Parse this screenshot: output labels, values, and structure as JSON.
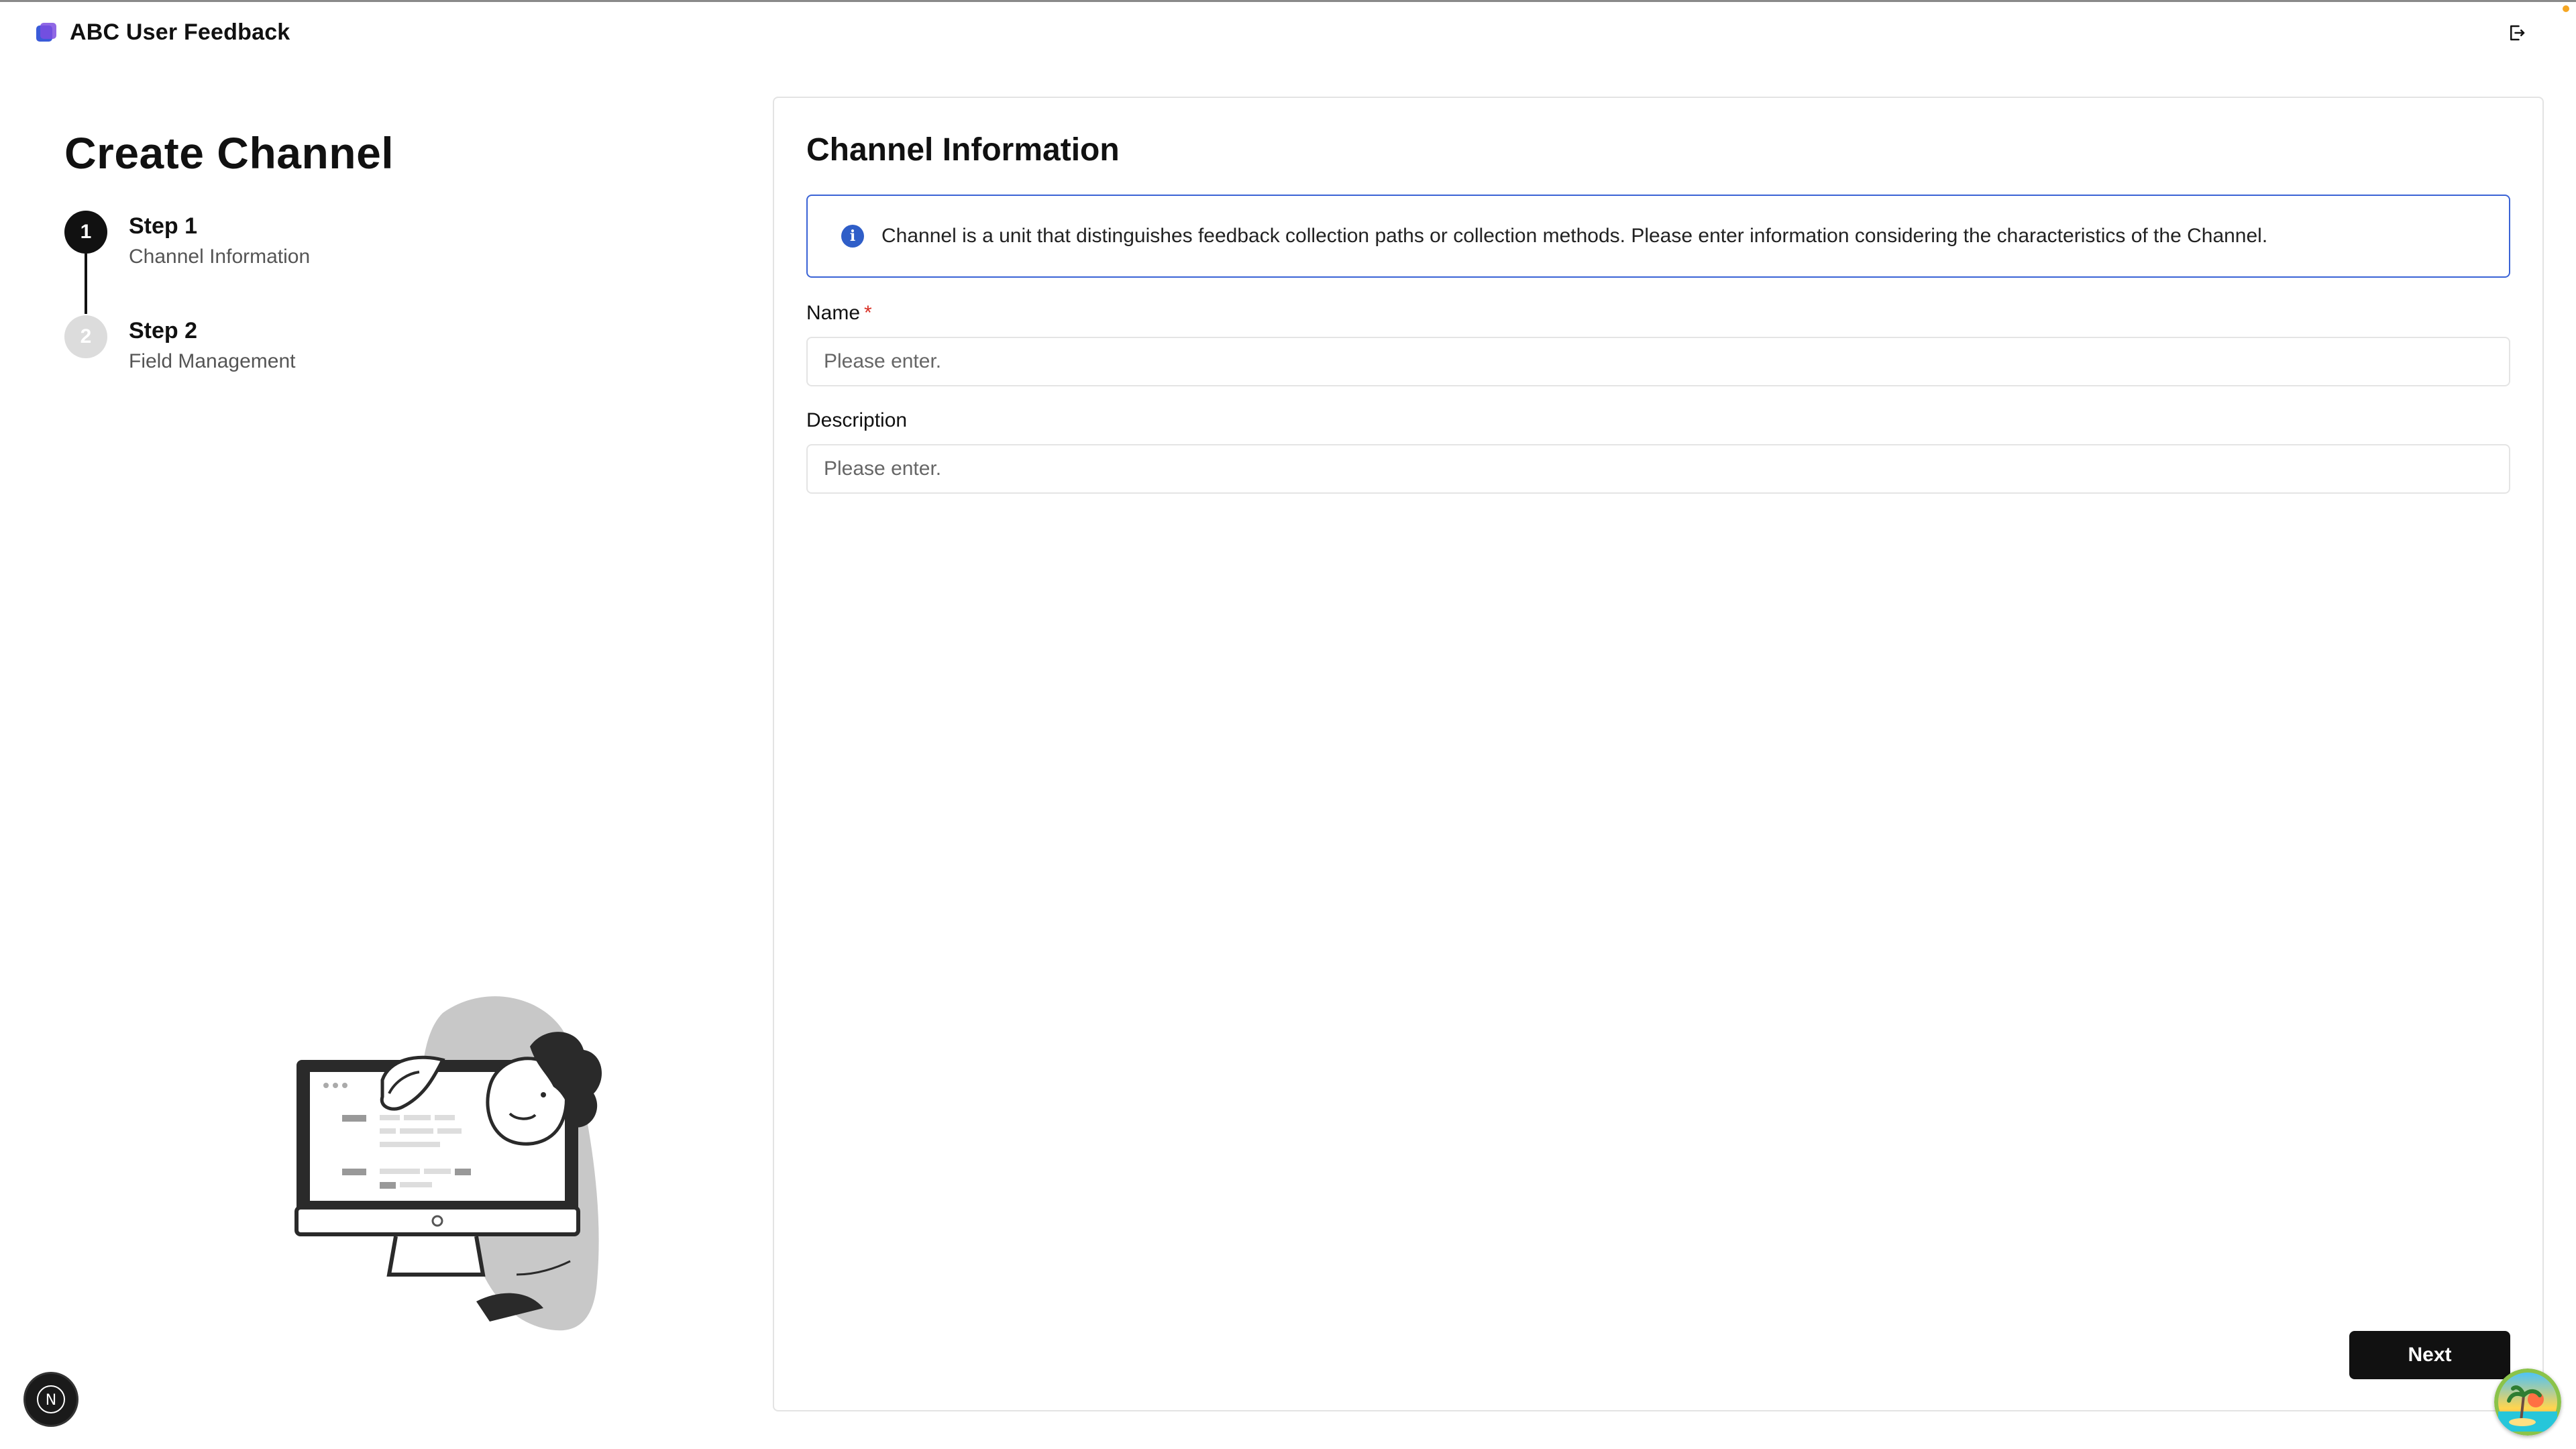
{
  "app": {
    "title": "ABC User Feedback",
    "icons": {
      "logo": "stacked-squares-logo",
      "logout": "logout-icon"
    },
    "colors": {
      "brand_blue": "#3a5bd9",
      "brand_purple": "#7c4de0",
      "notification": "#f5a623"
    }
  },
  "page": {
    "title": "Create Channel"
  },
  "steps": [
    {
      "number": "1",
      "title": "Step 1",
      "subtitle": "Channel Information",
      "state": "active"
    },
    {
      "number": "2",
      "title": "Step 2",
      "subtitle": "Field Management",
      "state": "inactive"
    }
  ],
  "form": {
    "title": "Channel Information",
    "info": {
      "icon": "info-icon",
      "text": "Channel is a unit that distinguishes feedback collection paths or collection methods. Please enter information considering the characteristics of the Channel.",
      "color": "#3a63d6"
    },
    "name": {
      "label": "Name",
      "required_mark": "*",
      "placeholder": "Please enter.",
      "value": ""
    },
    "description": {
      "label": "Description",
      "placeholder": "Please enter.",
      "value": ""
    },
    "next_label": "Next"
  },
  "widgets": {
    "dev_badge": {
      "letter": "N",
      "icon": "nextjs-badge-icon"
    },
    "avatar": {
      "icon": "tropical-island-avatar"
    }
  }
}
